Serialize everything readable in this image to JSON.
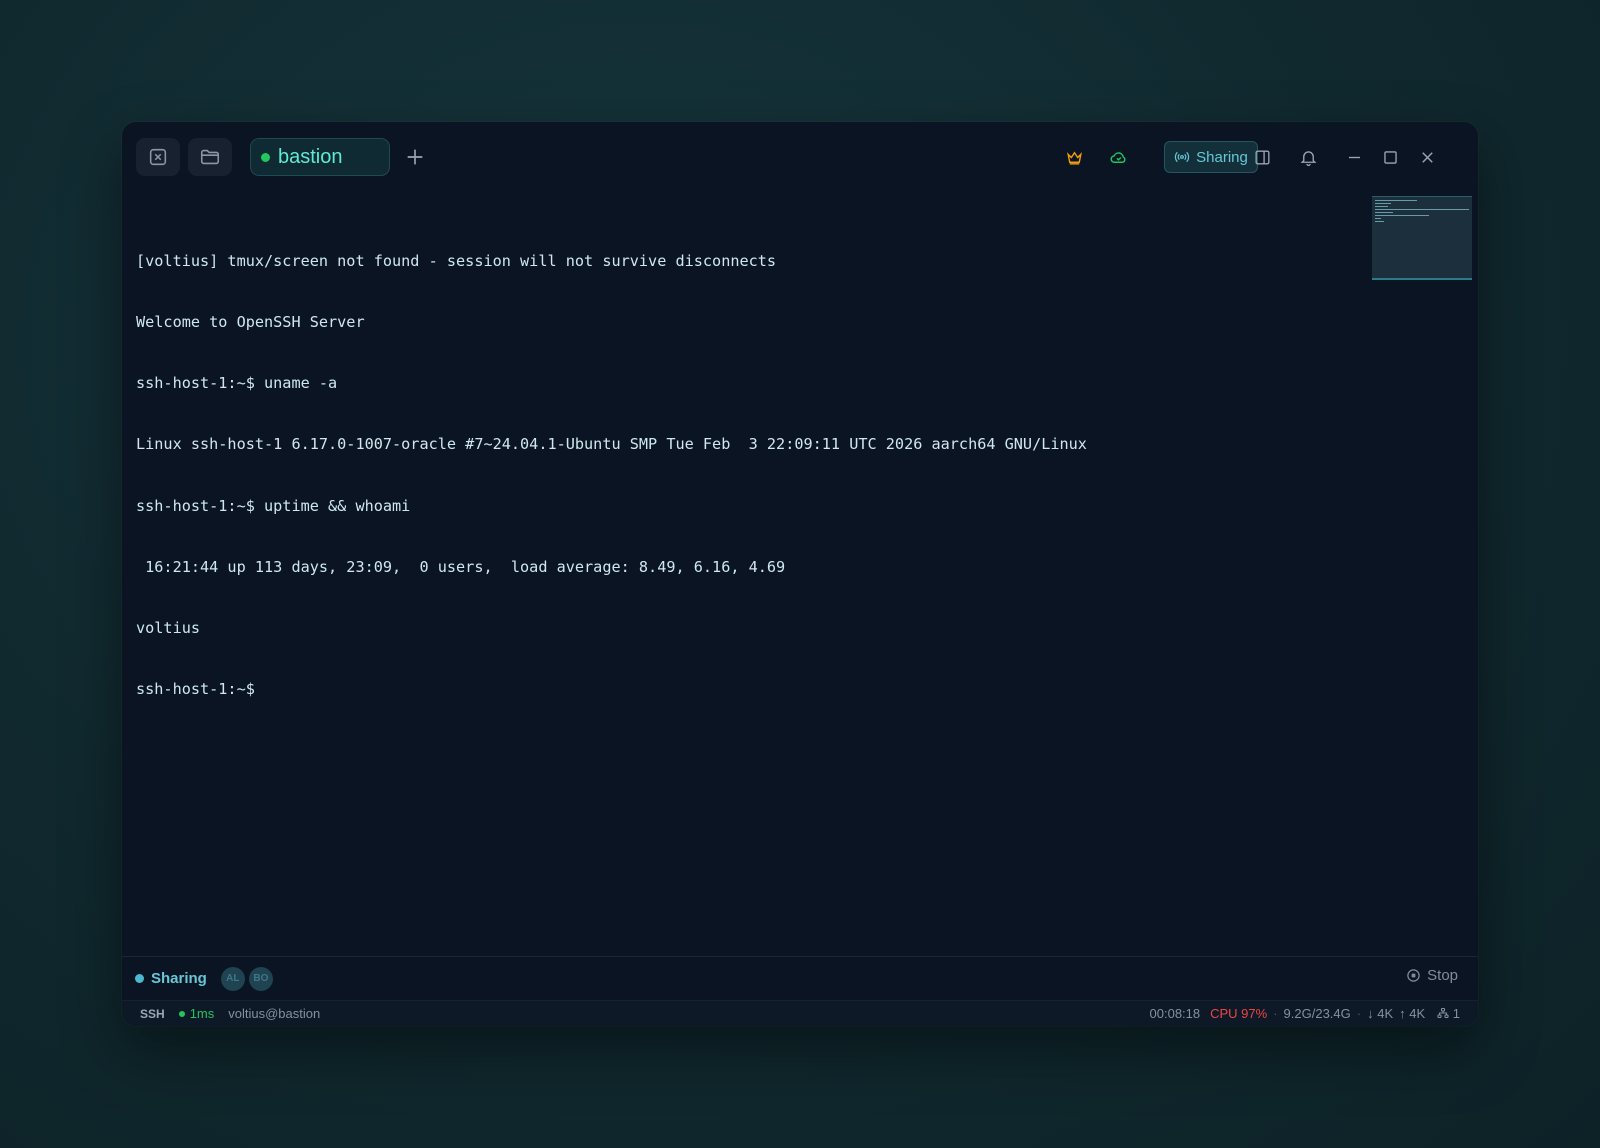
{
  "titlebar": {
    "tab": {
      "label": "bastion",
      "status_color": "#22c55e"
    },
    "sharing_label": "Sharing"
  },
  "terminal": {
    "lines": [
      "[voltius] tmux/screen not found - session will not survive disconnects",
      "Welcome to OpenSSH Server",
      "ssh-host-1:~$ uname -a",
      "Linux ssh-host-1 6.17.0-1007-oracle #7~24.04.1-Ubuntu SMP Tue Feb  3 22:09:11 UTC 2026 aarch64 GNU/Linux",
      "ssh-host-1:~$ uptime && whoami",
      " 16:21:44 up 113 days, 23:09,  0 users,  load average: 8.49, 6.16, 4.69",
      "voltius",
      "ssh-host-1:~$ "
    ]
  },
  "share_bar": {
    "label": "Sharing",
    "participants": [
      "AL",
      "BO"
    ],
    "stop_label": "Stop"
  },
  "status_bar": {
    "protocol": "SSH",
    "latency": "1ms",
    "user_host": "voltius@bastion",
    "elapsed": "00:08:18",
    "cpu": "CPU 97%",
    "memory": "9.2G/23.4G",
    "down": "↓ 4K",
    "up": "↑ 4K",
    "connections": "1"
  },
  "colors": {
    "accent": "#5eead4",
    "sharing": "#67c7d6",
    "online": "#22c55e",
    "cpu_alert": "#ef4444",
    "crown": "#f59e0b"
  }
}
